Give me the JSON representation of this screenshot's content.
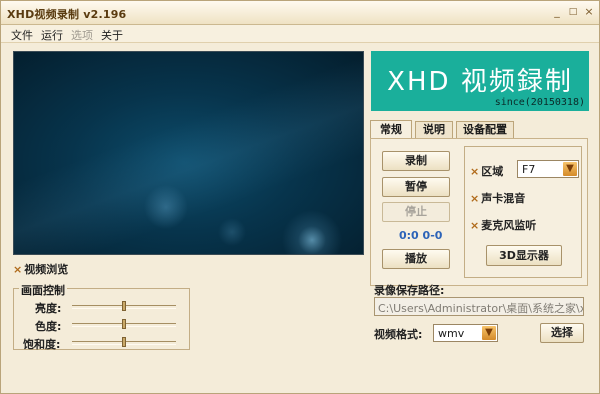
{
  "window": {
    "title": "XHD视频录制 v2.196",
    "minimize_glyph": "_",
    "maximize_glyph": "□",
    "close_glyph": "×"
  },
  "menu": [
    {
      "label": "文件",
      "enabled": true
    },
    {
      "label": "运行",
      "enabled": true
    },
    {
      "label": "选项",
      "enabled": false
    },
    {
      "label": "关于",
      "enabled": true
    }
  ],
  "logo": {
    "text": "XHD 视频録制",
    "since": "since(20150318)",
    "color": "#1aaf9b"
  },
  "tabs": [
    "常规",
    "说明",
    "设备配置"
  ],
  "controls": {
    "record": "录制",
    "pause": "暂停",
    "stop": "停止",
    "play": "播放",
    "counter": "0:0 0-0"
  },
  "options": {
    "region_label": "区域",
    "region_value": "F7",
    "soundcard_mix": "声卡混音",
    "mic_monitor": "麦克风监听",
    "display3d": "3D显示器",
    "checked_glyph": "×"
  },
  "preview_check": {
    "label": "视频浏览",
    "checked": true
  },
  "image_control": {
    "title": "画面控制",
    "brightness": "亮度:",
    "color": "色度:",
    "saturation": "饱和度:",
    "levels": {
      "brightness": 0.5,
      "color": 0.5,
      "saturation": 0.5
    }
  },
  "save": {
    "label": "录像保存路径:",
    "path": "C:\\Users\\Administrator\\桌面\\系统之家\\x"
  },
  "format": {
    "label": "视频格式:",
    "value": "wmv",
    "choose": "选择"
  },
  "icons": {
    "dropdown": "arrow-down-icon"
  },
  "colors": {
    "accent": "#1aaf9b",
    "window_bg": "#f4ecd9",
    "counter": "#2c63b8",
    "check": "#b06a1a"
  }
}
